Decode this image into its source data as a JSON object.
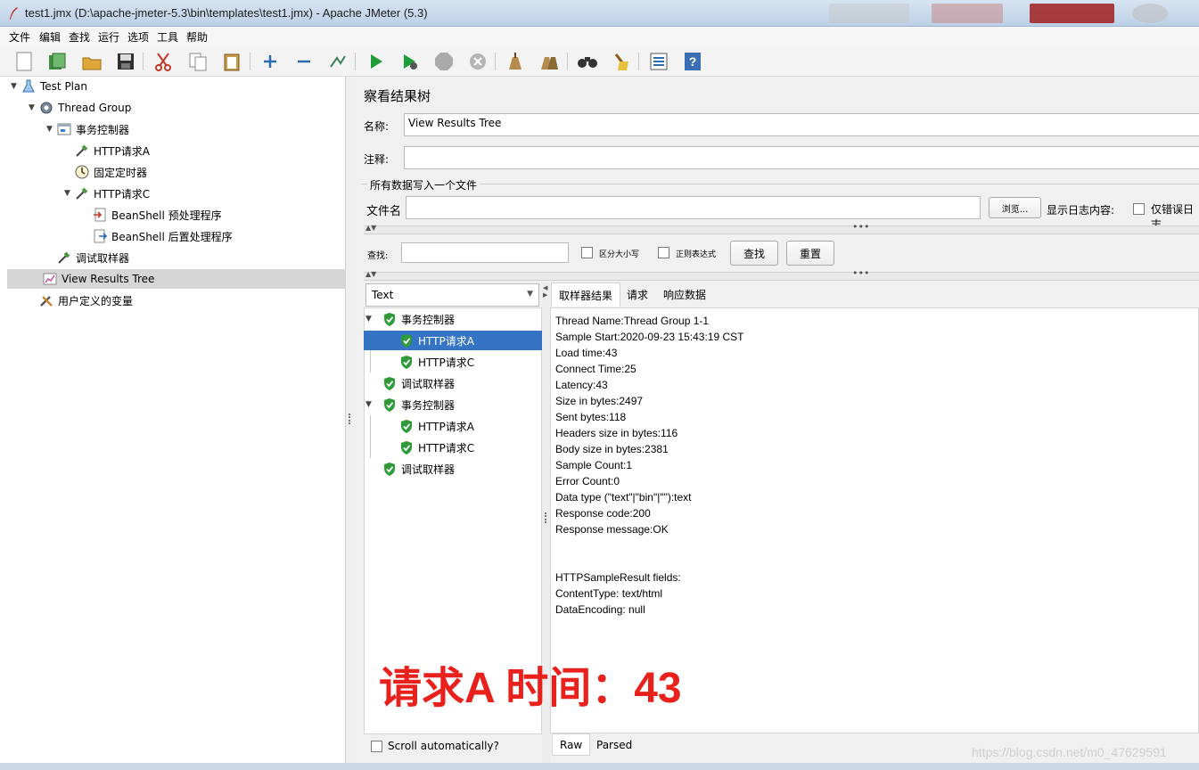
{
  "window": {
    "title": "test1.jmx (D:\\apache-jmeter-5.3\\bin\\templates\\test1.jmx) - Apache JMeter (5.3)"
  },
  "menu": [
    "文件",
    "编辑",
    "查找",
    "运行",
    "选项",
    "工具",
    "帮助"
  ],
  "toolbar_icons": [
    "new-icon",
    "templates-icon",
    "open-icon",
    "save-icon",
    "cut-icon",
    "copy-icon",
    "paste-icon",
    "expand-icon",
    "collapse-icon",
    "toggle-icon",
    "start-icon",
    "start-no-pause-icon",
    "stop-icon",
    "shutdown-icon",
    "clear-icon",
    "clear-all-icon",
    "search-icon",
    "reset-search-icon",
    "function-helper-icon",
    "help-icon"
  ],
  "tree": {
    "nodes": [
      {
        "label": "Test Plan",
        "icon": "test-plan-icon"
      },
      {
        "label": "Thread Group",
        "icon": "thread-group-icon"
      },
      {
        "label": "事务控制器",
        "icon": "transaction-controller-icon"
      },
      {
        "label": "HTTP请求A",
        "icon": "sampler-pipette-icon"
      },
      {
        "label": "固定定时器",
        "icon": "timer-icon"
      },
      {
        "label": "HTTP请求C",
        "icon": "sampler-pipette-icon"
      },
      {
        "label": "BeanShell 预处理程序",
        "icon": "preprocessor-icon"
      },
      {
        "label": "BeanShell 后置处理程序",
        "icon": "postprocessor-icon"
      },
      {
        "label": "调试取样器",
        "icon": "sampler-pipette-icon"
      },
      {
        "label": "View Results Tree",
        "icon": "results-tree-icon"
      },
      {
        "label": "用户定义的变量",
        "icon": "variables-tools-icon"
      }
    ]
  },
  "panel": {
    "heading": "察看结果树",
    "name_label": "名称:",
    "name_value": "View Results Tree",
    "comment_label": "注释:",
    "comment_value": "",
    "file_group_label": "所有数据写入一个文件",
    "filename_label": "文件名",
    "filename_value": "",
    "browse_label": "浏览...",
    "log_label": "显示日志内容:",
    "errors_only_label": "仅错误日志",
    "search_label": "查找:",
    "search_value": "",
    "case_label": "区分大小写",
    "regex_label": "正则表达式",
    "find_button": "查找",
    "reset_button": "重置",
    "renderer": "Text",
    "scroll_auto": "Scroll automatically?"
  },
  "results_tree": [
    {
      "label": "事务控制器",
      "status": "success"
    },
    {
      "label": "HTTP请求A",
      "status": "success"
    },
    {
      "label": "HTTP请求C",
      "status": "success"
    },
    {
      "label": "调试取样器",
      "status": "success"
    },
    {
      "label": "事务控制器",
      "status": "success"
    },
    {
      "label": "HTTP请求A",
      "status": "success"
    },
    {
      "label": "HTTP请求C",
      "status": "success"
    },
    {
      "label": "调试取样器",
      "status": "success"
    }
  ],
  "detail_tabs": [
    "取样器结果",
    "请求",
    "响应数据"
  ],
  "detail_lines": [
    "Thread Name:Thread Group 1-1",
    "Sample Start:2020-09-23 15:43:19 CST",
    "Load time:43",
    "Connect Time:25",
    "Latency:43",
    "Size in bytes:2497",
    "Sent bytes:118",
    "Headers size in bytes:116",
    "Body size in bytes:2381",
    "Sample Count:1",
    "Error Count:0",
    "Data type (\"text\"|\"bin\"|\"\"):text",
    "Response code:200",
    "Response message:OK",
    "",
    "",
    "HTTPSampleResult fields:",
    "ContentType: text/html",
    "DataEncoding: null"
  ],
  "bottom_tabs": [
    "Raw",
    "Parsed"
  ],
  "annotation": "请求A 时间：43",
  "watermark": "https://blog.csdn.net/m0_47629591",
  "colors": {
    "selection": "#3574c4",
    "success": "#2e9b3a",
    "annotation": "#e8211c"
  }
}
